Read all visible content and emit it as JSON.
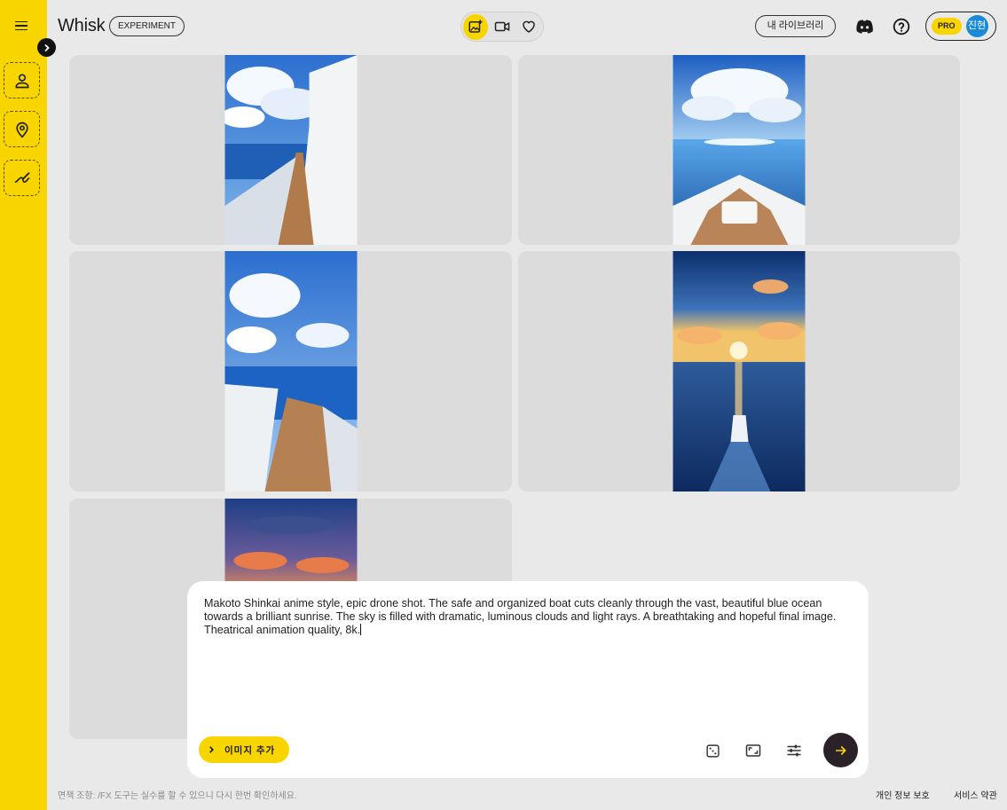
{
  "header": {
    "brand": "Whisk",
    "badge": "EXPERIMENT",
    "library_label": "내 라이브러리",
    "pro_label": "PRO",
    "avatar_text": "진현"
  },
  "icons": {
    "menu": "hamburger-menu-icon",
    "expand": "chevron-right-icon",
    "subject": "person-icon",
    "scene": "location-pin-icon",
    "style": "brush-icon",
    "image_mode": "image-add-icon",
    "video_mode": "video-icon",
    "favorites": "heart-icon",
    "discord": "discord-icon",
    "help": "help-circle-icon"
  },
  "prompt": {
    "text": "Makoto Shinkai anime style, epic drone shot. The safe and organized boat cuts cleanly through the vast, beautiful blue ocean towards a brilliant sunrise. The sky is filled with dramatic, luminous clouds and light rays. A breathtaking and hopeful final image. Theatrical animation quality, 8k.",
    "add_image_label": "이미지 추가"
  },
  "footer": {
    "disclaimer": "면책 조항: /FX 도구는 실수를 할 수 있으니 다시 한번 확인하세요.",
    "privacy": "개인 정보 보호",
    "terms": "서비스 약관"
  },
  "colors": {
    "accent": "#f9d500",
    "background": "#e9e9e9",
    "tile": "#dcdcdc",
    "submit": "#2b2128",
    "avatar": "#1a8ad8"
  }
}
